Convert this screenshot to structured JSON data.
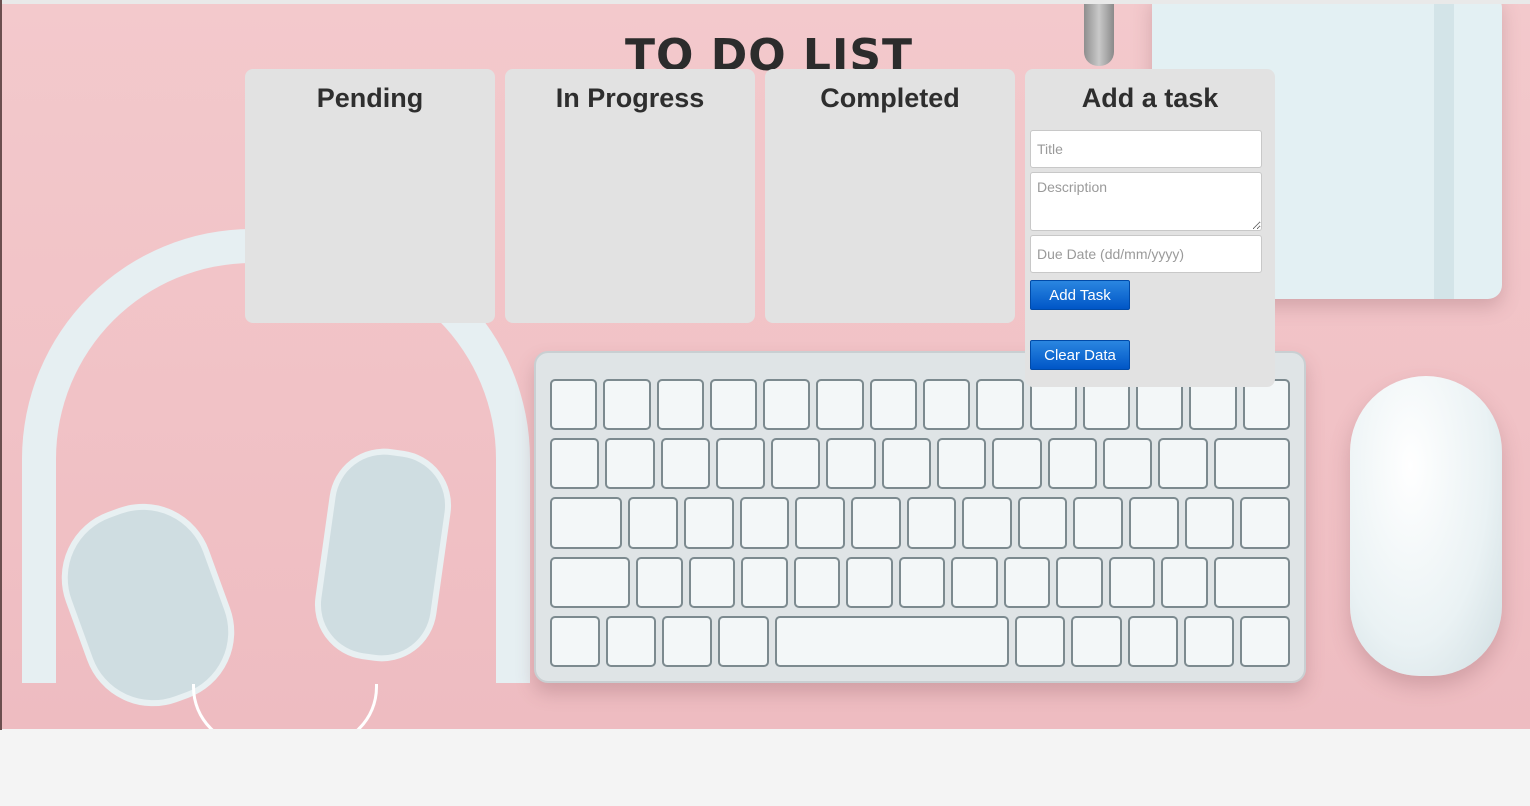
{
  "app": {
    "title": "TO DO LIST"
  },
  "boards": [
    {
      "title": "Pending"
    },
    {
      "title": "In Progress"
    },
    {
      "title": "Completed"
    }
  ],
  "add_task": {
    "heading": "Add a task",
    "title_placeholder": "Title",
    "description_placeholder": "Description",
    "due_date_placeholder": "Due Date (dd/mm/yyyy)",
    "add_button": "Add Task",
    "clear_button": "Clear Data"
  },
  "colors": {
    "background": "#f1c2c6",
    "panel": "#e2e2e2",
    "button": "#0056c7",
    "title_text": "#2c2c2c"
  }
}
